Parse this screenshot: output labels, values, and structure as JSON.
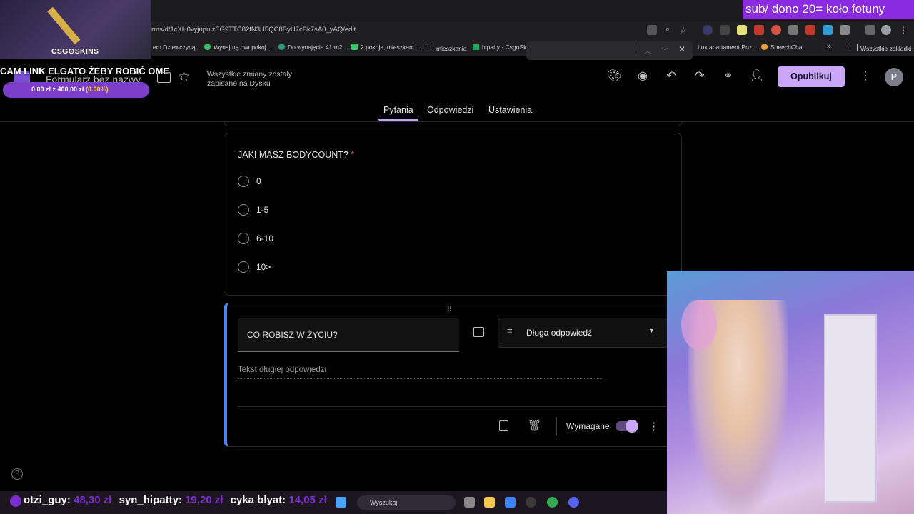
{
  "browser": {
    "url": "rms/d/1cXH0vyjupuizSG9TTC82fN3H5QC8ByU7cBk7sA0_yAQ/edit",
    "bookmarks": [
      "em Dziewczyną...",
      "Wynajmę dwupokoj...",
      "Do wynajęcia 41 m2...",
      "2 pokoje, mieszkani...",
      "mieszkania",
      "hipatty - CsgoSki",
      "Lux apartament Poz...",
      "SpeechChat",
      "Wszystkie zakładki"
    ]
  },
  "forms": {
    "title": "Formularz bez nazwy",
    "save_status": "Wszystkie zmiany zostały zapisane na Dysku",
    "publish_label": "Opublikuj",
    "avatar_letter": "P",
    "tabs": [
      "Pytania",
      "Odpowiedzi",
      "Ustawienia"
    ]
  },
  "question1": {
    "title": "JAKI MASZ BODYCOUNT?",
    "required_mark": "*",
    "options": [
      "0",
      "1-5",
      "6-10",
      "10>"
    ]
  },
  "question2": {
    "title": "CO ROBISZ W ŻYCIU?",
    "type": "Długa odpowiedź",
    "answer_placeholder": "Tekst długiej odpowiedzi",
    "required_label": "Wymagane",
    "required_on": true
  },
  "overlay": {
    "sponsor": "CSG⊙SKINS",
    "donation_goal": "sub/ dono 20= koło fotuny",
    "cam_banner": "CAM LINK ELGATO ŻEBY ROBIĆ OME",
    "progress_text": "0,00 zł z 400,00 zł",
    "progress_pct": "(0.00%)",
    "progress_value": 0.0,
    "ticker": [
      {
        "name": "otzi_guy:",
        "amount": "48,30 zł"
      },
      {
        "name": "syn_hipatty:",
        "amount": "19,20 zł"
      },
      {
        "name": "cyka blyat:",
        "amount": "14,05 zł"
      }
    ]
  },
  "taskbar": {
    "search_placeholder": "Wyszukaj"
  },
  "colors": {
    "accent": "#c9a6f7",
    "question_focus": "#4285f4",
    "overlay_purple": "#8a2be2"
  }
}
